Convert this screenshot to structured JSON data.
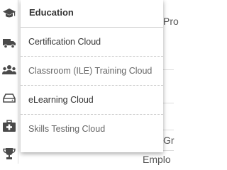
{
  "menu": {
    "header": "Education",
    "items": [
      {
        "label": "Certification Cloud"
      },
      {
        "label": "Classroom (ILE) Training Cloud"
      },
      {
        "label": "eLearning Cloud"
      },
      {
        "label": "Skills Testing Cloud"
      }
    ]
  },
  "background": {
    "fragment_top": "Pro",
    "fragment_mid": "Gr",
    "fragment_bottom": "Emplo"
  },
  "colors": {
    "icon_color": "#4a4a4a",
    "menu_text": "#333333"
  }
}
